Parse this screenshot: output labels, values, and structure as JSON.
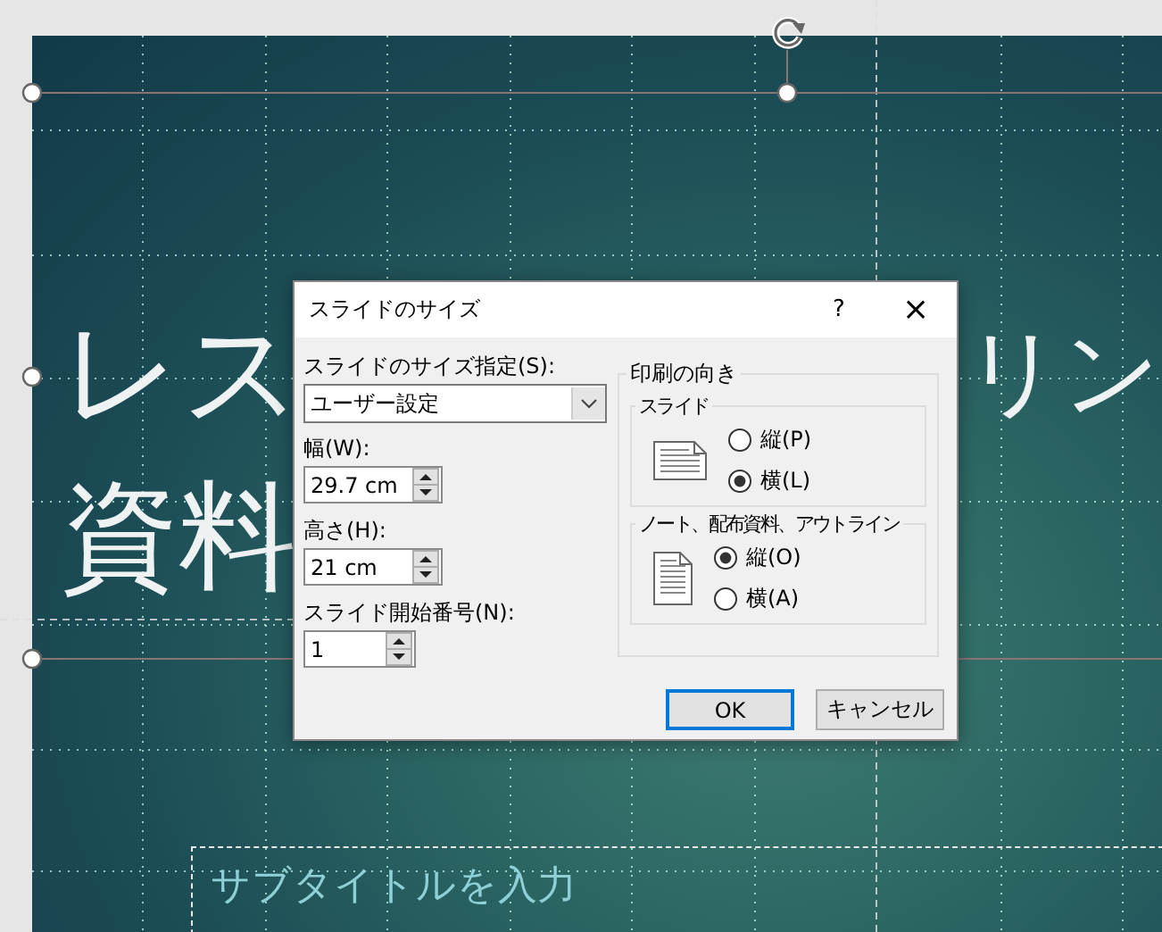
{
  "slide": {
    "title_line1_left": "レス",
    "title_line1_right": "リン",
    "title_line2": "資料",
    "subtitle_placeholder": "サブタイトルを入力"
  },
  "dialog": {
    "title": "スライドのサイズ",
    "help": "?",
    "close": "×",
    "fields": [
      {
        "kind": "dropdown",
        "label": "スライドのサイズ指定(S):",
        "value": "ユーザー設定"
      },
      {
        "kind": "spin",
        "label": "幅(W):",
        "value": "29.7 cm"
      },
      {
        "kind": "spin",
        "label": "高さ(H):",
        "value": "21 cm"
      },
      {
        "kind": "spin-small",
        "label": "スライド開始番号(N):",
        "value": "1"
      }
    ],
    "orientation": {
      "title": "印刷の向き",
      "groups": [
        {
          "title": "スライド",
          "kind": "landscape",
          "options": [
            {
              "label": "縦(P)",
              "selected": false
            },
            {
              "label": "横(L)",
              "selected": true
            }
          ]
        },
        {
          "title": "ノート、配布資料、アウトライン",
          "kind": "portrait",
          "options": [
            {
              "label": "縦(O)",
              "selected": true
            },
            {
              "label": "横(A)",
              "selected": false
            }
          ]
        }
      ]
    },
    "buttons": [
      {
        "label": "OK",
        "default": true
      },
      {
        "label": "キャンセル",
        "default": false
      }
    ]
  }
}
